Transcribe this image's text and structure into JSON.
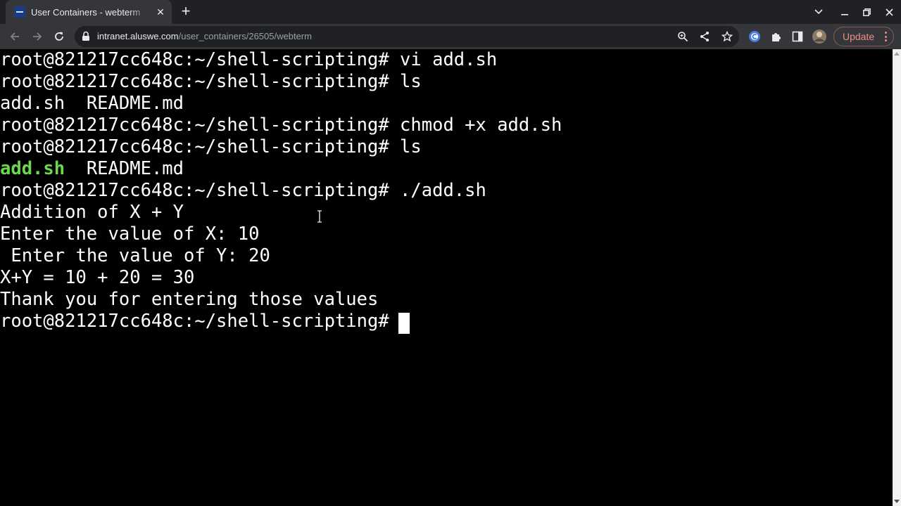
{
  "tab": {
    "title": "User Containers - webterm",
    "close_glyph": "✕",
    "favicon": "webterm-favicon"
  },
  "new_tab_glyph": "+",
  "window_controls": [
    "chevron-down-icon",
    "minimize-icon",
    "restore-icon",
    "close-icon"
  ],
  "address_bar": {
    "host": "intranet.aluswe.com",
    "path": "/user_containers/26505/webterm"
  },
  "toolbar": {
    "update_label": "Update",
    "icons": [
      "back-icon",
      "forward-icon",
      "reload-icon",
      "lock-icon",
      "zoom-icon",
      "share-icon",
      "bookmark-star-icon",
      "extension-c-icon",
      "extensions-puzzle-icon",
      "sidepanel-icon",
      "profile-avatar"
    ]
  },
  "colors": {
    "terminal_bg": "#000000",
    "terminal_fg": "#ffffff",
    "executable_green": "#6bd94b",
    "update_accent": "#f28b82",
    "toolbar_bg": "#35363a",
    "tabstrip_bg": "#202124"
  },
  "terminal": {
    "lines": [
      {
        "text": "root@821217cc648c:~/shell-scripting# vi add.sh"
      },
      {
        "text": "root@821217cc648c:~/shell-scripting# ls"
      },
      {
        "text": "add.sh  README.md"
      },
      {
        "text": "root@821217cc648c:~/shell-scripting# chmod +x add.sh"
      },
      {
        "text": "root@821217cc648c:~/shell-scripting# ls"
      },
      {
        "exec": "add.sh",
        "rest": "  README.md"
      },
      {
        "text": "root@821217cc648c:~/shell-scripting# ./add.sh"
      },
      {
        "text": "Addition of X + Y"
      },
      {
        "text": "Enter the value of X: 10"
      },
      {
        "text": " Enter the value of Y: 20"
      },
      {
        "text": "X+Y = 10 + 20 = 30"
      },
      {
        "text": "Thank you for entering those values"
      },
      {
        "text": "root@821217cc648c:~/shell-scripting# "
      }
    ]
  }
}
